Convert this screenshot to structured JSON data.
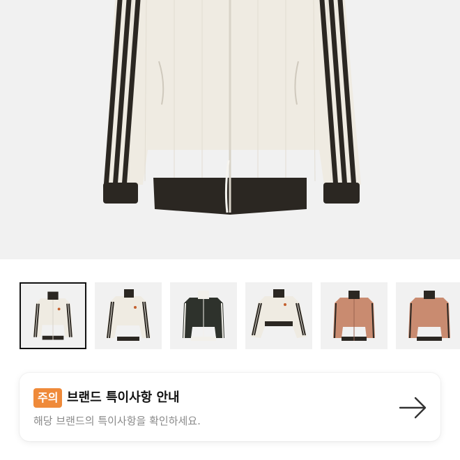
{
  "product": {
    "main_image_icon": "track-jacket-cream",
    "thumbnails": [
      {
        "icon": "track-jacket-cream-front",
        "selected": true
      },
      {
        "icon": "track-jacket-cream-angle",
        "selected": false
      },
      {
        "icon": "track-jacket-black",
        "selected": false
      },
      {
        "icon": "track-jacket-cream-black-collar",
        "selected": false
      },
      {
        "icon": "track-jacket-pink-black",
        "selected": false
      },
      {
        "icon": "track-jacket-pink-black-2",
        "selected": false
      }
    ]
  },
  "notice": {
    "badge": "주의",
    "title": "브랜드 특이사항 안내",
    "description": "해당 브랜드의 특이사항을 확인하세요.",
    "arrow_icon": "arrow-right-icon"
  },
  "colors": {
    "badge": "#ef8a3a",
    "hero_bg": "#f1f1f1",
    "jacket_cream": "#efebe2",
    "stripe_dark": "#2b2722",
    "jacket_pink": "#c98b70"
  }
}
